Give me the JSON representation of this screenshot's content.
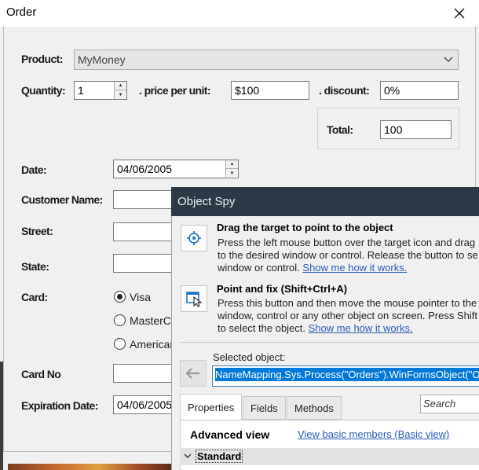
{
  "order_window": {
    "title": "Order",
    "product": {
      "label": "Product:",
      "value": "MyMoney"
    },
    "quantity": {
      "label": "Quantity:",
      "value": "1"
    },
    "price": {
      "label": ". price per unit:",
      "value": "$100"
    },
    "discount": {
      "label": ". discount:",
      "value": "0%"
    },
    "total": {
      "label": "Total:",
      "value": "100"
    },
    "date": {
      "label": "Date:",
      "value": "04/06/2005"
    },
    "customer_name": {
      "label": "Customer Name:",
      "value": ""
    },
    "street": {
      "label": "Street:",
      "value": ""
    },
    "state": {
      "label": "State:",
      "value": ""
    },
    "card": {
      "label": "Card:",
      "options": [
        "Visa",
        "MasterC",
        "Americar"
      ],
      "selected": "Visa"
    },
    "card_no": {
      "label": "Card No",
      "value": ""
    },
    "expiration": {
      "label": "Expiration Date:",
      "value": "04/06/2005"
    }
  },
  "object_spy": {
    "title": "Object Spy",
    "drag": {
      "heading": "Drag the target to point to the object",
      "line1": "Press the left mouse button over the target icon and drag",
      "line2": "to the desired window or control. Release the button to se",
      "line3": "window or control.",
      "link": "Show me how it works."
    },
    "point_fix": {
      "heading": "Point and fix (Shift+Ctrl+A)",
      "line1": "Press this button and then move the mouse pointer to the",
      "line2": "window, control or any other object on screen. Press Shift",
      "line3": "to select the object.",
      "link": "Show me how it works."
    },
    "selected_label": "Selected object:",
    "selected_value": "NameMapping.Sys.Process(\"Orders\").WinFormsObject(\"Or",
    "tabs": [
      "Properties",
      "Fields",
      "Methods"
    ],
    "search_placeholder": "Search",
    "advanced_view": "Advanced view",
    "basic_view_link": "View basic members (Basic view)",
    "standard_group": "Standard"
  },
  "colors": {
    "spy_titlebar": "#2b3a46",
    "link": "#2b5bb5",
    "selection": "#0078d7"
  }
}
